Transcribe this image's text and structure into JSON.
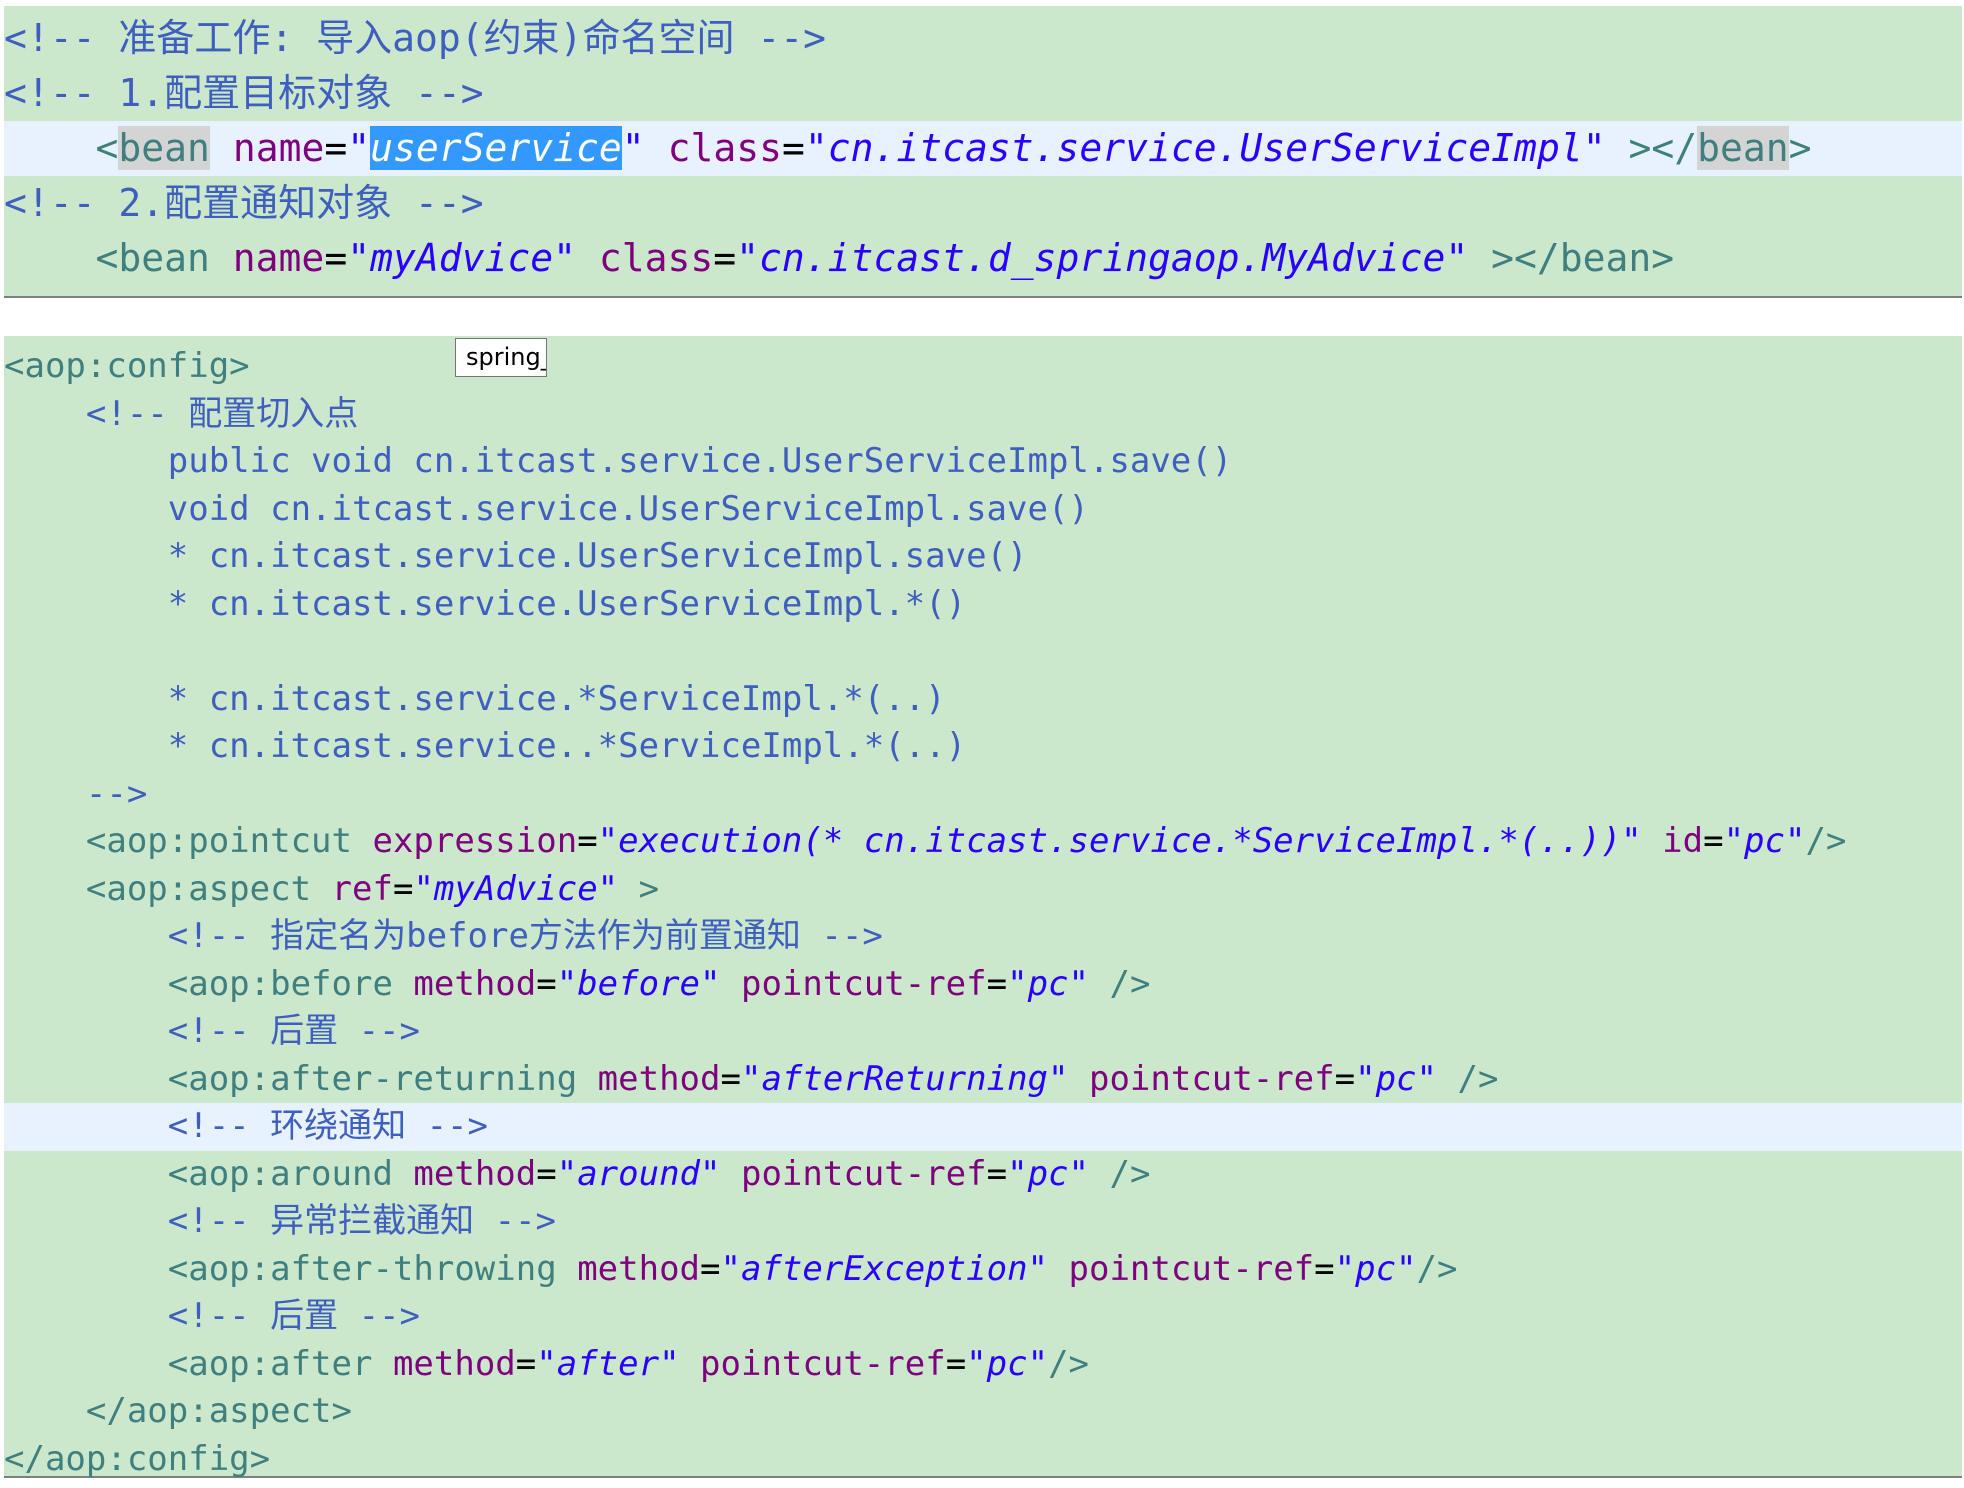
{
  "top_editor": {
    "lines": [
      {
        "indent": "",
        "segments": [
          {
            "t": "cmt",
            "v": "<!-- 准备工作: 导入aop(约束)命名空间 -->"
          }
        ]
      },
      {
        "indent": "",
        "segments": [
          {
            "t": "cmt",
            "v": "<!-- 1.配置目标对象 -->"
          }
        ]
      },
      {
        "indent": "    ",
        "current": true,
        "segments": [
          {
            "t": "tag",
            "v": "<"
          },
          {
            "t": "tag",
            "v": "bean",
            "hl": true
          },
          {
            "t": "plain",
            "v": " "
          },
          {
            "t": "attr",
            "v": "name"
          },
          {
            "t": "plain",
            "v": "="
          },
          {
            "t": "val",
            "v": "\""
          },
          {
            "t": "val",
            "v": "userService",
            "sel": true
          },
          {
            "t": "val",
            "v": "\""
          },
          {
            "t": "plain",
            "v": " "
          },
          {
            "t": "attr",
            "v": "class"
          },
          {
            "t": "plain",
            "v": "="
          },
          {
            "t": "val",
            "v": "\"cn.itcast.service.UserServiceImpl\""
          },
          {
            "t": "plain",
            "v": " "
          },
          {
            "t": "tag",
            "v": "></"
          },
          {
            "t": "tag",
            "v": "bean",
            "hl": true
          },
          {
            "t": "tag",
            "v": ">"
          }
        ]
      },
      {
        "indent": "",
        "segments": [
          {
            "t": "cmt",
            "v": "<!-- 2.配置通知对象 -->"
          }
        ]
      },
      {
        "indent": "    ",
        "segments": [
          {
            "t": "tag",
            "v": "<bean"
          },
          {
            "t": "plain",
            "v": " "
          },
          {
            "t": "attr",
            "v": "name"
          },
          {
            "t": "plain",
            "v": "="
          },
          {
            "t": "val",
            "v": "\"myAdvice\""
          },
          {
            "t": "plain",
            "v": " "
          },
          {
            "t": "attr",
            "v": "class"
          },
          {
            "t": "plain",
            "v": "="
          },
          {
            "t": "val",
            "v": "\"cn.itcast.d_springaop.MyAdvice\""
          },
          {
            "t": "plain",
            "v": " "
          },
          {
            "t": "tag",
            "v": "></bean>"
          }
        ]
      }
    ]
  },
  "bottom_editor": {
    "lines": [
      {
        "indent": "",
        "segments": [
          {
            "t": "tag",
            "v": "<aop:config>"
          }
        ]
      },
      {
        "indent": "    ",
        "segments": [
          {
            "t": "cmt",
            "v": "<!-- 配置切入点"
          }
        ]
      },
      {
        "indent": "        ",
        "segments": [
          {
            "t": "cmt",
            "v": "public void cn.itcast.service.UserServiceImpl.save()"
          }
        ]
      },
      {
        "indent": "        ",
        "segments": [
          {
            "t": "cmt",
            "v": "void cn.itcast.service.UserServiceImpl.save()"
          }
        ]
      },
      {
        "indent": "        ",
        "segments": [
          {
            "t": "cmt",
            "v": "* cn.itcast.service.UserServiceImpl.save()"
          }
        ]
      },
      {
        "indent": "        ",
        "segments": [
          {
            "t": "cmt",
            "v": "* cn.itcast.service.UserServiceImpl.*()"
          }
        ]
      },
      {
        "indent": "",
        "segments": []
      },
      {
        "indent": "        ",
        "segments": [
          {
            "t": "cmt",
            "v": "* cn.itcast.service.*ServiceImpl.*(..)"
          }
        ]
      },
      {
        "indent": "        ",
        "segments": [
          {
            "t": "cmt",
            "v": "* cn.itcast.service..*ServiceImpl.*(..)"
          }
        ]
      },
      {
        "indent": "    ",
        "segments": [
          {
            "t": "cmt",
            "v": "-->"
          }
        ]
      },
      {
        "indent": "    ",
        "segments": [
          {
            "t": "tag",
            "v": "<aop:pointcut"
          },
          {
            "t": "plain",
            "v": " "
          },
          {
            "t": "attr",
            "v": "expression"
          },
          {
            "t": "plain",
            "v": "="
          },
          {
            "t": "val",
            "v": "\"execution(* cn.itcast.service.*ServiceImpl.*(..))\""
          },
          {
            "t": "plain",
            "v": " "
          },
          {
            "t": "attr",
            "v": "id"
          },
          {
            "t": "plain",
            "v": "="
          },
          {
            "t": "val",
            "v": "\"pc\""
          },
          {
            "t": "tag",
            "v": "/>"
          }
        ]
      },
      {
        "indent": "    ",
        "segments": [
          {
            "t": "tag",
            "v": "<aop:aspect"
          },
          {
            "t": "plain",
            "v": " "
          },
          {
            "t": "attr",
            "v": "ref"
          },
          {
            "t": "plain",
            "v": "="
          },
          {
            "t": "val",
            "v": "\"myAdvice\""
          },
          {
            "t": "plain",
            "v": " "
          },
          {
            "t": "tag",
            "v": ">"
          }
        ]
      },
      {
        "indent": "        ",
        "segments": [
          {
            "t": "cmt",
            "v": "<!-- 指定名为before方法作为前置通知 -->"
          }
        ]
      },
      {
        "indent": "        ",
        "segments": [
          {
            "t": "tag",
            "v": "<aop:before"
          },
          {
            "t": "plain",
            "v": " "
          },
          {
            "t": "attr",
            "v": "method"
          },
          {
            "t": "plain",
            "v": "="
          },
          {
            "t": "val",
            "v": "\"before\""
          },
          {
            "t": "plain",
            "v": " "
          },
          {
            "t": "attr",
            "v": "pointcut-ref"
          },
          {
            "t": "plain",
            "v": "="
          },
          {
            "t": "val",
            "v": "\"pc\""
          },
          {
            "t": "plain",
            "v": " "
          },
          {
            "t": "tag",
            "v": "/>"
          }
        ]
      },
      {
        "indent": "        ",
        "segments": [
          {
            "t": "cmt",
            "v": "<!-- 后置 -->"
          }
        ]
      },
      {
        "indent": "        ",
        "segments": [
          {
            "t": "tag",
            "v": "<aop:after-returning"
          },
          {
            "t": "plain",
            "v": " "
          },
          {
            "t": "attr",
            "v": "method"
          },
          {
            "t": "plain",
            "v": "="
          },
          {
            "t": "val",
            "v": "\"afterReturning\""
          },
          {
            "t": "plain",
            "v": " "
          },
          {
            "t": "attr",
            "v": "pointcut-ref"
          },
          {
            "t": "plain",
            "v": "="
          },
          {
            "t": "val",
            "v": "\"pc\""
          },
          {
            "t": "plain",
            "v": " "
          },
          {
            "t": "tag",
            "v": "/>"
          }
        ]
      },
      {
        "indent": "        ",
        "current": true,
        "segments": [
          {
            "t": "cmt",
            "v": "<!-- 环绕通知 -->"
          }
        ]
      },
      {
        "indent": "        ",
        "segments": [
          {
            "t": "tag",
            "v": "<aop:around"
          },
          {
            "t": "plain",
            "v": " "
          },
          {
            "t": "attr",
            "v": "method"
          },
          {
            "t": "plain",
            "v": "="
          },
          {
            "t": "val",
            "v": "\"around\""
          },
          {
            "t": "plain",
            "v": " "
          },
          {
            "t": "attr",
            "v": "pointcut-ref"
          },
          {
            "t": "plain",
            "v": "="
          },
          {
            "t": "val",
            "v": "\"pc\""
          },
          {
            "t": "plain",
            "v": " "
          },
          {
            "t": "tag",
            "v": "/>"
          }
        ]
      },
      {
        "indent": "        ",
        "segments": [
          {
            "t": "cmt",
            "v": "<!-- 异常拦截通知 -->"
          }
        ]
      },
      {
        "indent": "        ",
        "segments": [
          {
            "t": "tag",
            "v": "<aop:after-throwing"
          },
          {
            "t": "plain",
            "v": " "
          },
          {
            "t": "attr",
            "v": "method"
          },
          {
            "t": "plain",
            "v": "="
          },
          {
            "t": "val",
            "v": "\"afterException\""
          },
          {
            "t": "plain",
            "v": " "
          },
          {
            "t": "attr",
            "v": "pointcut-ref"
          },
          {
            "t": "plain",
            "v": "="
          },
          {
            "t": "val",
            "v": "\"pc\""
          },
          {
            "t": "tag",
            "v": "/>"
          }
        ]
      },
      {
        "indent": "        ",
        "segments": [
          {
            "t": "cmt",
            "v": "<!-- 后置 -->"
          }
        ]
      },
      {
        "indent": "        ",
        "segments": [
          {
            "t": "tag",
            "v": "<aop:after"
          },
          {
            "t": "plain",
            "v": " "
          },
          {
            "t": "attr",
            "v": "method"
          },
          {
            "t": "plain",
            "v": "="
          },
          {
            "t": "val",
            "v": "\"after\""
          },
          {
            "t": "plain",
            "v": " "
          },
          {
            "t": "attr",
            "v": "pointcut-ref"
          },
          {
            "t": "plain",
            "v": "="
          },
          {
            "t": "val",
            "v": "\"pc\""
          },
          {
            "t": "tag",
            "v": "/>"
          }
        ]
      },
      {
        "indent": "    ",
        "segments": [
          {
            "t": "tag",
            "v": "</aop:aspect>"
          }
        ]
      },
      {
        "indent": "",
        "segments": [
          {
            "t": "tag",
            "v": "</aop:config>"
          }
        ]
      }
    ]
  },
  "tooltip": {
    "text": "spring_"
  },
  "colors": {
    "editor_bg": "#cce8cc",
    "current_line": "#e8f2fe",
    "tag": "#3f7f7f",
    "attribute": "#7f007f",
    "value": "#2a00ff",
    "comment": "#3f5fbf",
    "selection": "#3399ff"
  }
}
